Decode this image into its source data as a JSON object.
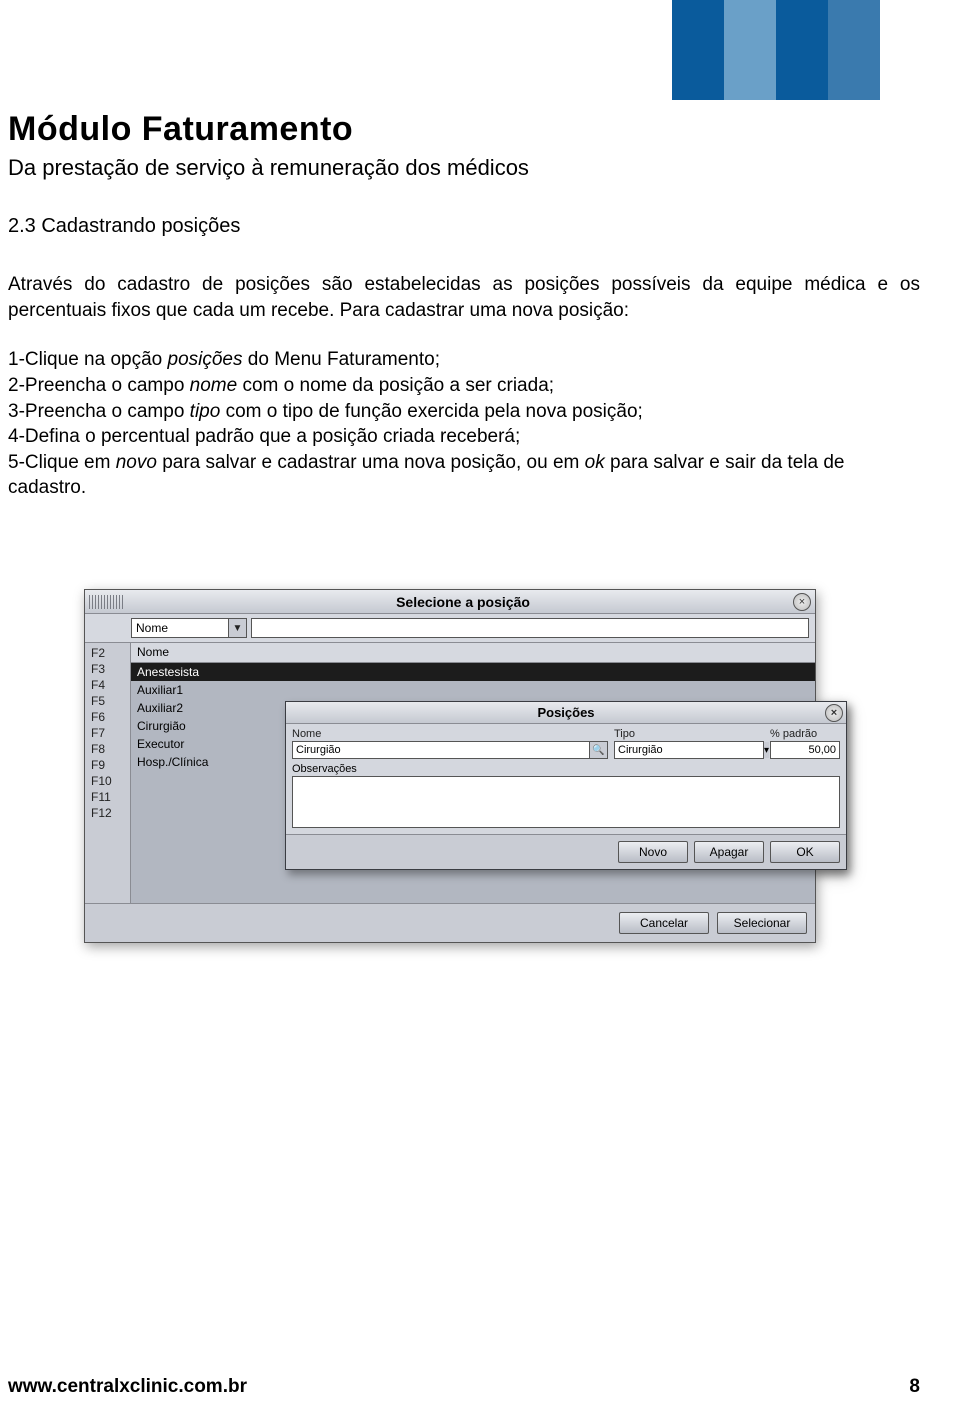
{
  "header": {
    "title": "Módulo Faturamento",
    "subtitle": "Da prestação de serviço à remuneração dos médicos"
  },
  "section": {
    "heading": "2.3 Cadastrando posições",
    "paragraph": "Através do cadastro de posições são estabelecidas as posições possíveis da equipe médica e os percentuais fixos que cada um recebe. Para cadastrar uma nova posição:",
    "steps": {
      "s1a": "1-Clique na opção ",
      "s1i": "posições",
      "s1b": " do Menu Faturamento;",
      "s2a": "2-Preencha o campo ",
      "s2i": "nome",
      "s2b": " com o nome da posição a ser criada;",
      "s3a": "3-Preencha o campo ",
      "s3i": "tipo",
      "s3b": " com o tipo de função exercida pela nova posição;",
      "s4": "4-Defina o percentual padrão que a posição criada receberá;",
      "s5a": "5-Clique em ",
      "s5i": "novo",
      "s5b": " para salvar e cadastrar uma nova posição, ou em ",
      "s5i2": "ok",
      "s5c": " para salvar e sair da tela de cadastro."
    }
  },
  "win1": {
    "title": "Selecione a posição",
    "filter_combo": "Nome",
    "list_header": "Nome",
    "fkeys": [
      "F2",
      "F3",
      "F4",
      "F5",
      "F6",
      "F7",
      "F8",
      "F9",
      "F10",
      "F11",
      "F12"
    ],
    "rows": [
      "Anestesista",
      "Auxiliar1",
      "Auxiliar2",
      "Cirurgião",
      "Executor",
      "Hosp./Clínica"
    ],
    "btn_cancel": "Cancelar",
    "btn_select": "Selecionar"
  },
  "win2": {
    "title": "Posições",
    "lbl_nome": "Nome",
    "val_nome": "Cirurgião",
    "lbl_tipo": "Tipo",
    "val_tipo": "Cirurgião",
    "lbl_pct": "% padrão",
    "val_pct": "50,00",
    "lbl_obs": "Observações",
    "btn_novo": "Novo",
    "btn_apagar": "Apagar",
    "btn_ok": "OK"
  },
  "footer": {
    "url": "www.centralxclinic.com.br",
    "page": "8"
  }
}
